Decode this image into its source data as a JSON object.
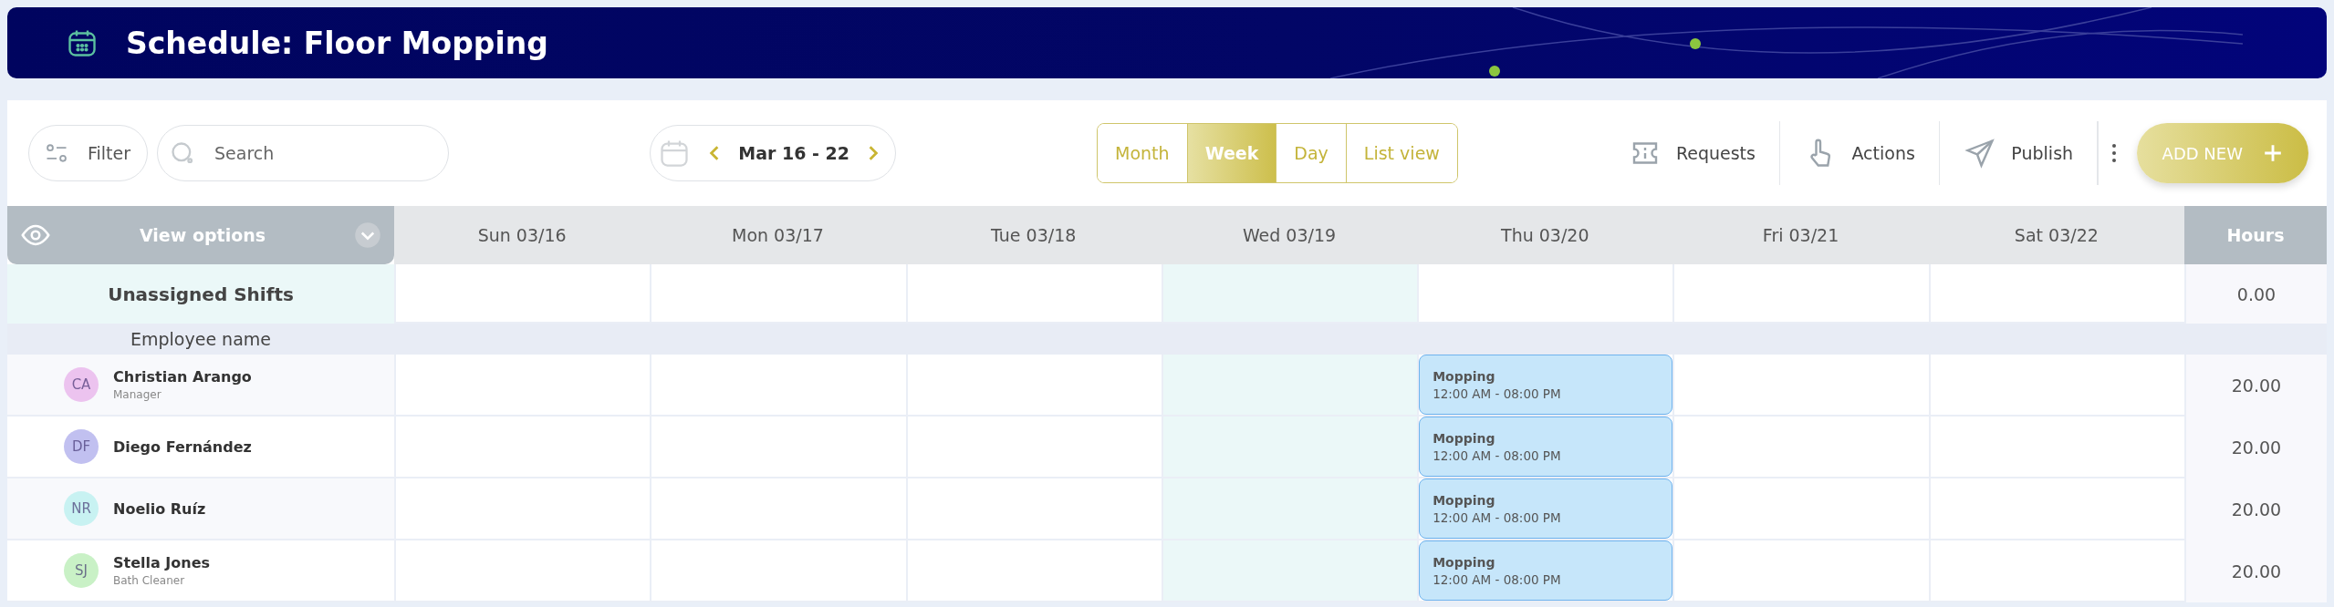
{
  "header": {
    "title": "Schedule: Floor Mopping"
  },
  "toolbar": {
    "filter": "Filter",
    "search": {
      "placeholder": "Search"
    },
    "date_range": "Mar 16 - 22",
    "views": [
      {
        "label": "Month",
        "selected": false
      },
      {
        "label": "Week",
        "selected": true
      },
      {
        "label": "Day",
        "selected": false
      },
      {
        "label": "List view",
        "selected": false
      }
    ],
    "actions": [
      {
        "kind": "requests",
        "label": "Requests"
      },
      {
        "kind": "actions",
        "label": "Actions"
      },
      {
        "kind": "publish",
        "label": "Publish"
      }
    ],
    "add_button": "ADD NEW"
  },
  "grid": {
    "view_options": "View options",
    "days": [
      {
        "label": "Sun 03/16",
        "today": false
      },
      {
        "label": "Mon 03/17",
        "today": false
      },
      {
        "label": "Tue 03/18",
        "today": false
      },
      {
        "label": "Wed 03/19",
        "today": true
      },
      {
        "label": "Thu 03/20",
        "today": false
      },
      {
        "label": "Fri 03/21",
        "today": false
      },
      {
        "label": "Sat 03/22",
        "today": false
      }
    ],
    "hours_header": "Hours",
    "unassigned": {
      "label": "Unassigned Shifts",
      "hours": "0.00"
    },
    "employee_header": "Employee name",
    "employees": [
      {
        "initials": "CA",
        "name": "Christian Arango",
        "role": "Manager",
        "color": "#ecc3ef",
        "hours": "20.00",
        "cells": [
          {
            "kind": "empty"
          },
          {
            "kind": "empty"
          },
          {
            "kind": "empty"
          },
          {
            "kind": "empty"
          },
          {
            "kind": "shift",
            "title": "Mopping",
            "time": "12:00 AM - 08:00 PM"
          },
          {
            "kind": "empty"
          },
          {
            "kind": "empty"
          }
        ]
      },
      {
        "initials": "DF",
        "name": "Diego Fernández",
        "color": "#c1c0f0",
        "hours": "20.00",
        "cells": [
          {
            "kind": "empty"
          },
          {
            "kind": "empty"
          },
          {
            "kind": "empty"
          },
          {
            "kind": "empty"
          },
          {
            "kind": "shift",
            "title": "Mopping",
            "time": "12:00 AM - 08:00 PM"
          },
          {
            "kind": "empty"
          },
          {
            "kind": "empty"
          }
        ]
      },
      {
        "initials": "NR",
        "name": "Noelio Ruíz",
        "color": "#c8f2f2",
        "hours": "20.00",
        "cells": [
          {
            "kind": "empty"
          },
          {
            "kind": "empty"
          },
          {
            "kind": "empty"
          },
          {
            "kind": "empty"
          },
          {
            "kind": "shift",
            "title": "Mopping",
            "time": "12:00 AM - 08:00 PM"
          },
          {
            "kind": "empty"
          },
          {
            "kind": "empty"
          }
        ]
      },
      {
        "initials": "SJ",
        "name": "Stella Jones",
        "role": "Bath Cleaner",
        "color": "#c9f1c6",
        "hours": "20.00",
        "cells": [
          {
            "kind": "empty"
          },
          {
            "kind": "empty"
          },
          {
            "kind": "empty"
          },
          {
            "kind": "empty"
          },
          {
            "kind": "shift",
            "title": "Mopping",
            "time": "12:00 AM - 08:00 PM"
          },
          {
            "kind": "empty"
          },
          {
            "kind": "empty"
          }
        ]
      }
    ]
  }
}
